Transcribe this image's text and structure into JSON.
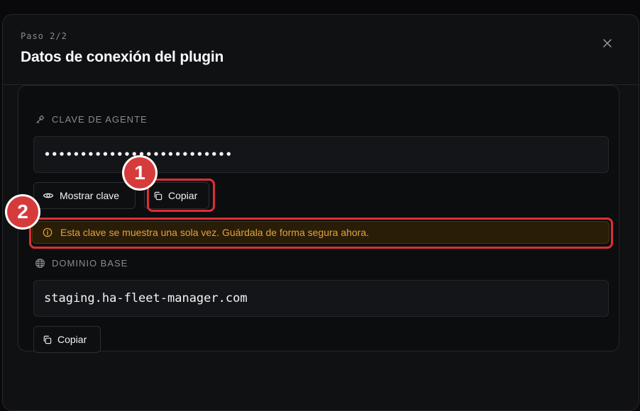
{
  "modal": {
    "step": "Paso 2/2",
    "title": "Datos de conexión del plugin",
    "close_icon": "close-icon"
  },
  "agent_key": {
    "label": "CLAVE DE AGENTE",
    "icon": "key-icon",
    "value": "••••••••••••••••••••••••••",
    "show_button": "Mostrar clave",
    "copy_button": "Copiar"
  },
  "warning": {
    "icon": "info-icon",
    "text": "Esta clave se muestra una sola vez. Guárdala de forma segura ahora."
  },
  "base_domain": {
    "label": "DOMINIO BASE",
    "icon": "globe-icon",
    "value": "staging.ha-fleet-manager.com",
    "copy_button": "Copiar"
  },
  "annotations": [
    {
      "number": "1"
    },
    {
      "number": "2"
    }
  ],
  "colors": {
    "annotation": "#dc2f35",
    "warning_text": "#e0a43b",
    "warning_bg": "#2a1d08"
  }
}
